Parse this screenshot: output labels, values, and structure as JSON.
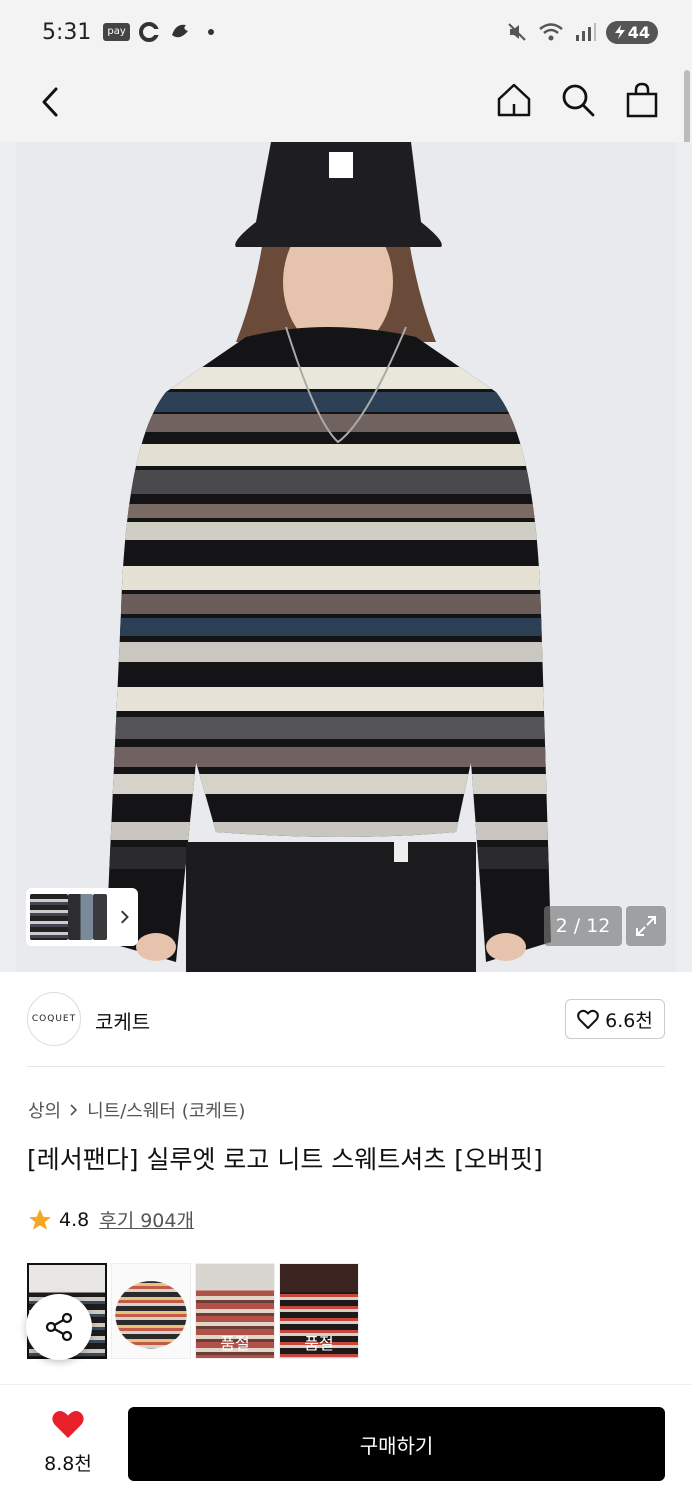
{
  "status_bar": {
    "time": "5:31",
    "pay_badge": "pay",
    "battery": "44"
  },
  "nav": {
    "back_icon": "chevron-left-icon",
    "home_icon": "home-icon",
    "search_icon": "search-icon",
    "bag_icon": "shopping-bag-icon"
  },
  "gallery": {
    "counter": "2 / 12"
  },
  "brand": {
    "logo_text": "COQUET",
    "name": "코케트",
    "like_count": "6.6천"
  },
  "breadcrumb": {
    "category": "상의",
    "subcategory": "니트/스웨터 (코케트)"
  },
  "product": {
    "title": "[레서팬다] 실루엣 로고 니트 스웨트셔츠 [오버핏]",
    "rating": "4.8",
    "reviews": "후기 904개"
  },
  "variants": [
    {
      "soldout": ""
    },
    {
      "soldout": ""
    },
    {
      "soldout": "품절"
    },
    {
      "soldout": "품절"
    }
  ],
  "bottom": {
    "wish_count": "8.8천",
    "buy_label": "구매하기"
  },
  "colors": {
    "accent_heart": "#e8202a",
    "star": "#f5a623",
    "buy_button": "#000000"
  }
}
